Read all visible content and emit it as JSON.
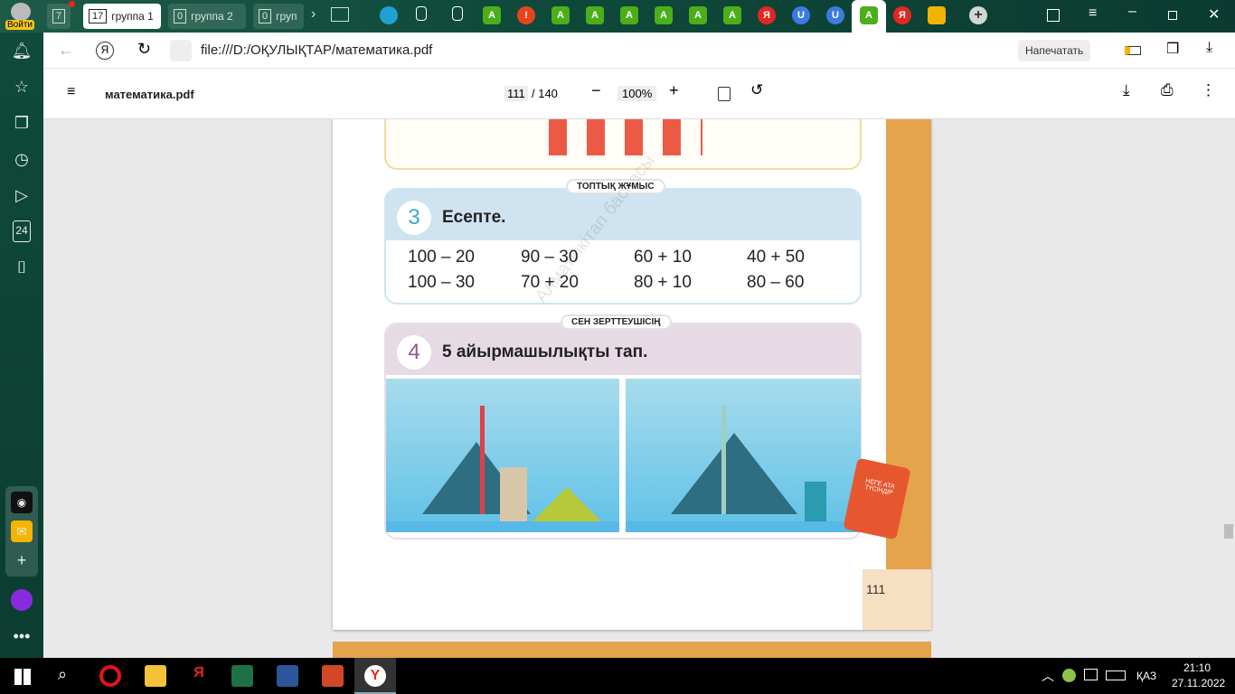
{
  "topbar": {
    "login": "Войти",
    "home_count": "7",
    "groups": [
      {
        "count": "17",
        "label": "группа 1"
      },
      {
        "count": "0",
        "label": "группа 2"
      },
      {
        "count": "0",
        "label": "груп"
      }
    ]
  },
  "address": {
    "url": "file:///D:/ОҚУЛЫҚТАР/математика.pdf",
    "print": "Напечатать"
  },
  "pdf": {
    "filename": "математика.pdf",
    "page": "111",
    "total": "/ 140",
    "zoom": "100%"
  },
  "page": {
    "task3": {
      "tag": "ТОПТЫҚ ЖҰМЫС",
      "number": "3",
      "title": "Есепте.",
      "expressions": [
        "100 – 20",
        "90 – 30",
        "60 + 10",
        "40 + 50",
        "100 – 30",
        "70 + 20",
        "80 + 10",
        "80 – 60"
      ]
    },
    "task4": {
      "tag": "СЕН ЗЕРТТЕУШІСІҢ",
      "number": "4",
      "title": "5 айырмашылықты тап."
    },
    "watermark": "Алматыкітап баспасы",
    "mascot_text": "НЕГЕ АТА ТҮСІНДІР",
    "page_number": "111"
  },
  "sidebar": {
    "badge_24": "24"
  },
  "taskbar": {
    "lang": "ҚАЗ",
    "time": "21:10",
    "date": "27.11.2022"
  }
}
